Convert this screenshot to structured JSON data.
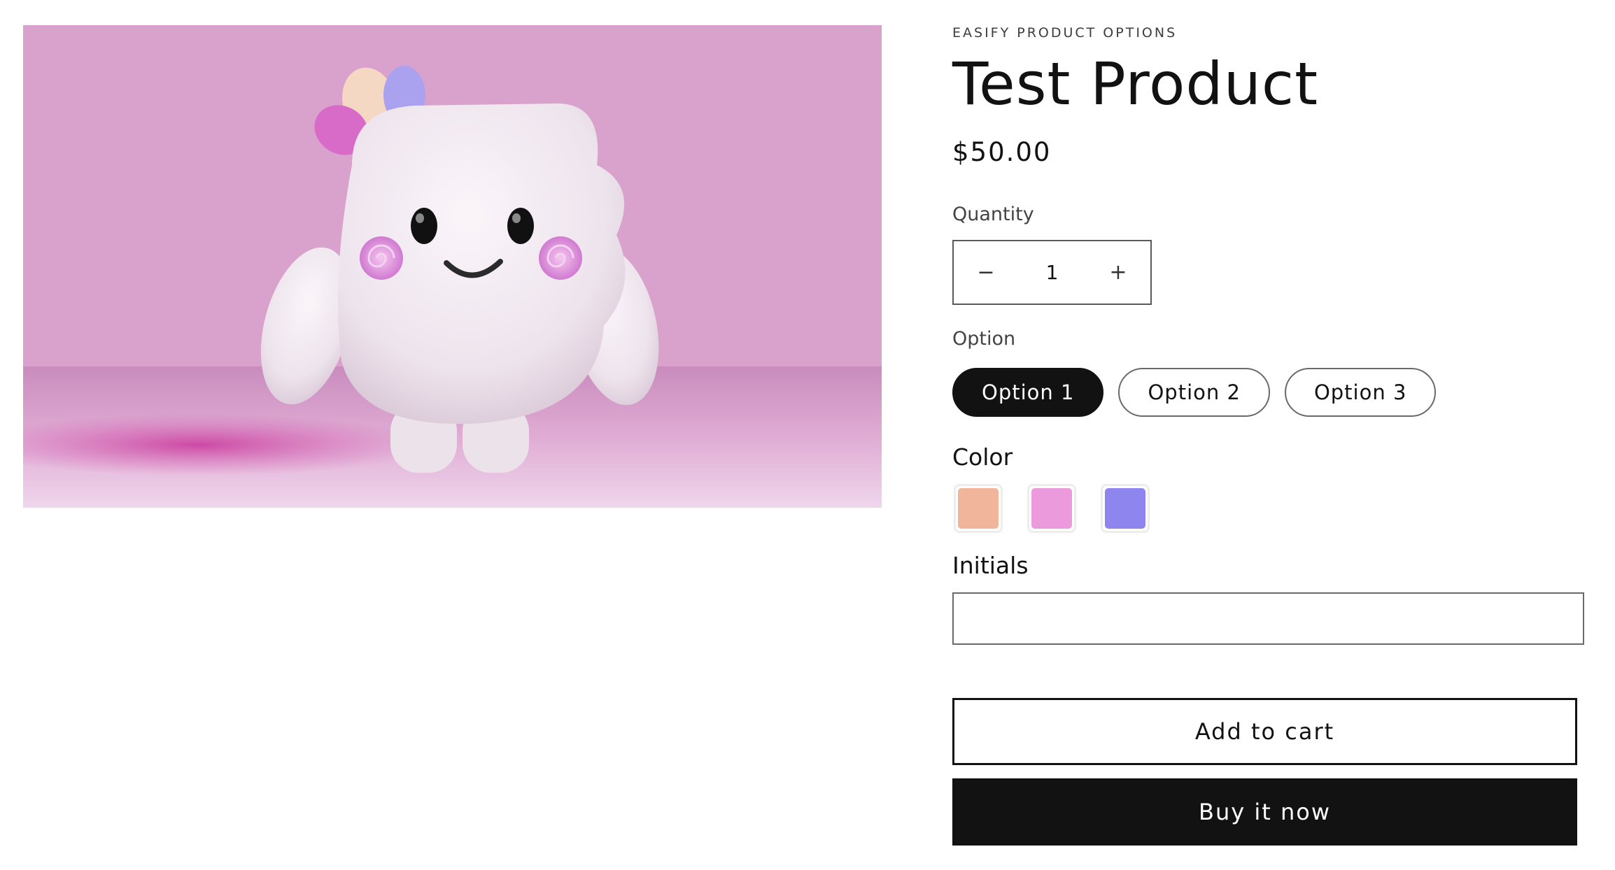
{
  "product": {
    "vendor": "EASIFY PRODUCT OPTIONS",
    "title": "Test Product",
    "price": "$50.00",
    "image_description": "3D white marshmallow character with pink cheeks on a pink background"
  },
  "quantity": {
    "label": "Quantity",
    "minus_symbol": "−",
    "value": "1",
    "plus_symbol": "+"
  },
  "option": {
    "label": "Option",
    "choices": [
      "Option 1",
      "Option 2",
      "Option 3"
    ],
    "selected": "Option 1"
  },
  "color": {
    "label": "Color",
    "swatches": [
      "#f0b59b",
      "#eb9bdc",
      "#8e86ee"
    ]
  },
  "initials": {
    "label": "Initials",
    "value": ""
  },
  "actions": {
    "add_to_cart": "Add to cart",
    "buy_now": "Buy it now"
  }
}
